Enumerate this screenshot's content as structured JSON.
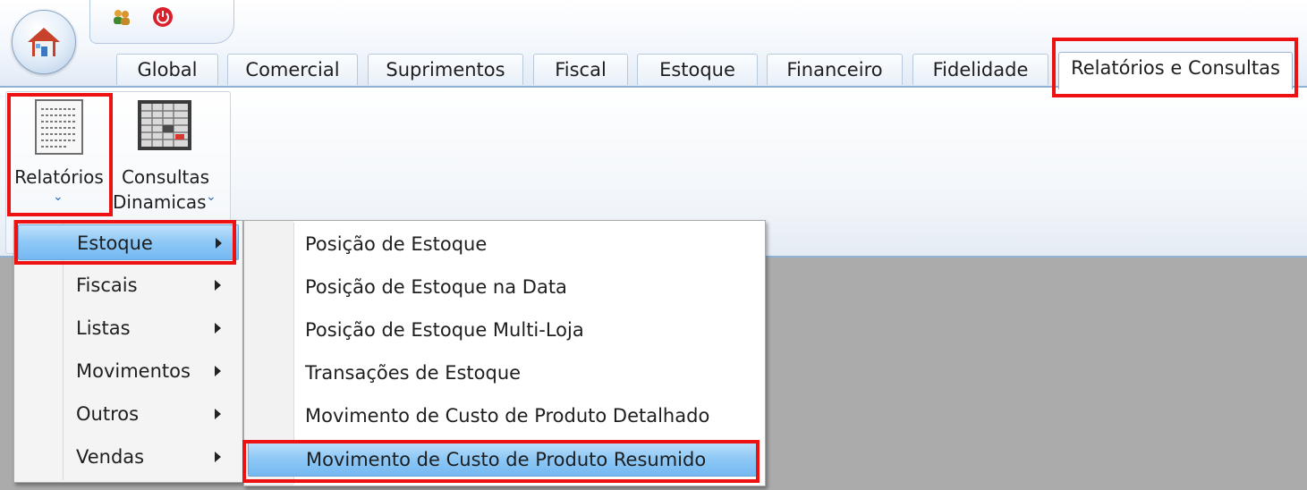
{
  "tabs": [
    "Global",
    "Comercial",
    "Suprimentos",
    "Fiscal",
    "Estoque",
    "Financeiro",
    "Fidelidade",
    "Relatórios e Consultas"
  ],
  "active_tab": "Relatórios e Consultas",
  "ribbon": {
    "relatorios_label": "Relatórios",
    "consultas_label_line1": "Consultas",
    "consultas_label_line2": "Dinamicas",
    "chevron": "⌄"
  },
  "menu": {
    "items": [
      "Estoque",
      "Fiscais",
      "Listas",
      "Movimentos",
      "Outros",
      "Vendas"
    ],
    "selected": "Estoque"
  },
  "submenu": {
    "items": [
      "Posição de Estoque",
      "Posição de Estoque na Data",
      "Posição de Estoque Multi-Loja",
      "Transações de Estoque",
      "Movimento de Custo de Produto Detalhado",
      "Movimento de Custo de Produto Resumido"
    ],
    "selected": "Movimento de Custo de Produto Resumido"
  },
  "icons": {
    "app_orb": "home-icon",
    "qat_1": "users-icon",
    "qat_2": "power-icon",
    "relatorios": "report-document-icon",
    "consultas": "spreadsheet-icon"
  },
  "colors": {
    "highlight_border": "#ee1111",
    "selection_blue": "#8ec8f6",
    "workspace_gray": "#ababab"
  }
}
